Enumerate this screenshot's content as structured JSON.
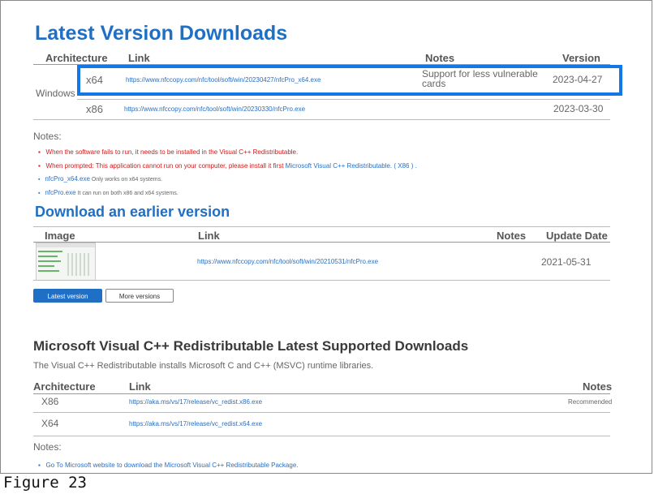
{
  "latest": {
    "title": "Latest Version Downloads",
    "headers": {
      "arch": "Architecture",
      "link": "Link",
      "notes": "Notes",
      "version": "Version"
    },
    "os_label": "Windows",
    "rows": [
      {
        "arch": "x64",
        "link": "https://www.nfccopy.com/nfc/tool/soft/win/20230427/nfcPro_x64.exe",
        "notes_line1": "Support for less vulnerable",
        "notes_line2": "cards",
        "version": "2023-04-27"
      },
      {
        "arch": "x86",
        "link": "https://www.nfccopy.com/nfc/tool/soft/win/20230330/nfcPro.exe",
        "notes_line1": "",
        "notes_line2": "",
        "version": "2023-03-30"
      }
    ]
  },
  "notes1": {
    "label": "Notes:",
    "items": [
      {
        "text": "When the software fails to run, it needs to be installed in the Visual C++ Redistributable."
      },
      {
        "text": "When prompted: This application cannot run on your computer, please install it first",
        "link": "Microsoft Visual C++ Redistributable. ( X86 ) ."
      },
      {
        "link": "nfcPro_x64.exe",
        "text": "Only works on x64 systems."
      },
      {
        "link": "nfcPro.exe",
        "text": "It can run on both x86 and x64 systems."
      }
    ]
  },
  "earlier": {
    "title": "Download an earlier version",
    "headers": {
      "image": "Image",
      "link": "Link",
      "notes": "Notes",
      "date": "Update Date"
    },
    "row": {
      "link": "https://www.nfccopy.com/nfc/tool/soft/win/20210531/nfcPro.exe",
      "date": "2021-05-31"
    }
  },
  "buttons": {
    "latest": "Latest version",
    "more": "More versions"
  },
  "msvc": {
    "title": "Microsoft Visual C++ Redistributable Latest Supported Downloads",
    "desc": "The Visual C++ Redistributable installs Microsoft C and C++ (MSVC) runtime libraries.",
    "headers": {
      "arch": "Architecture",
      "link": "Link",
      "notes": "Notes"
    },
    "rows": [
      {
        "arch": "X86",
        "link": "https://aka.ms/vs/17/release/vc_redist.x86.exe",
        "notes": "Recommended"
      },
      {
        "arch": "X64",
        "link": "https://aka.ms/vs/17/release/vc_redist.x64.exe",
        "notes": ""
      }
    ]
  },
  "notes2": {
    "label": "Notes:",
    "item": "Go To Microsoft website to download the Microsoft Visual C++ Redistributable Package."
  },
  "caption": "Figure 23",
  "colors": {
    "accent": "#1f6fc4",
    "highlight": "#1377e8",
    "warning": "#d21919"
  }
}
